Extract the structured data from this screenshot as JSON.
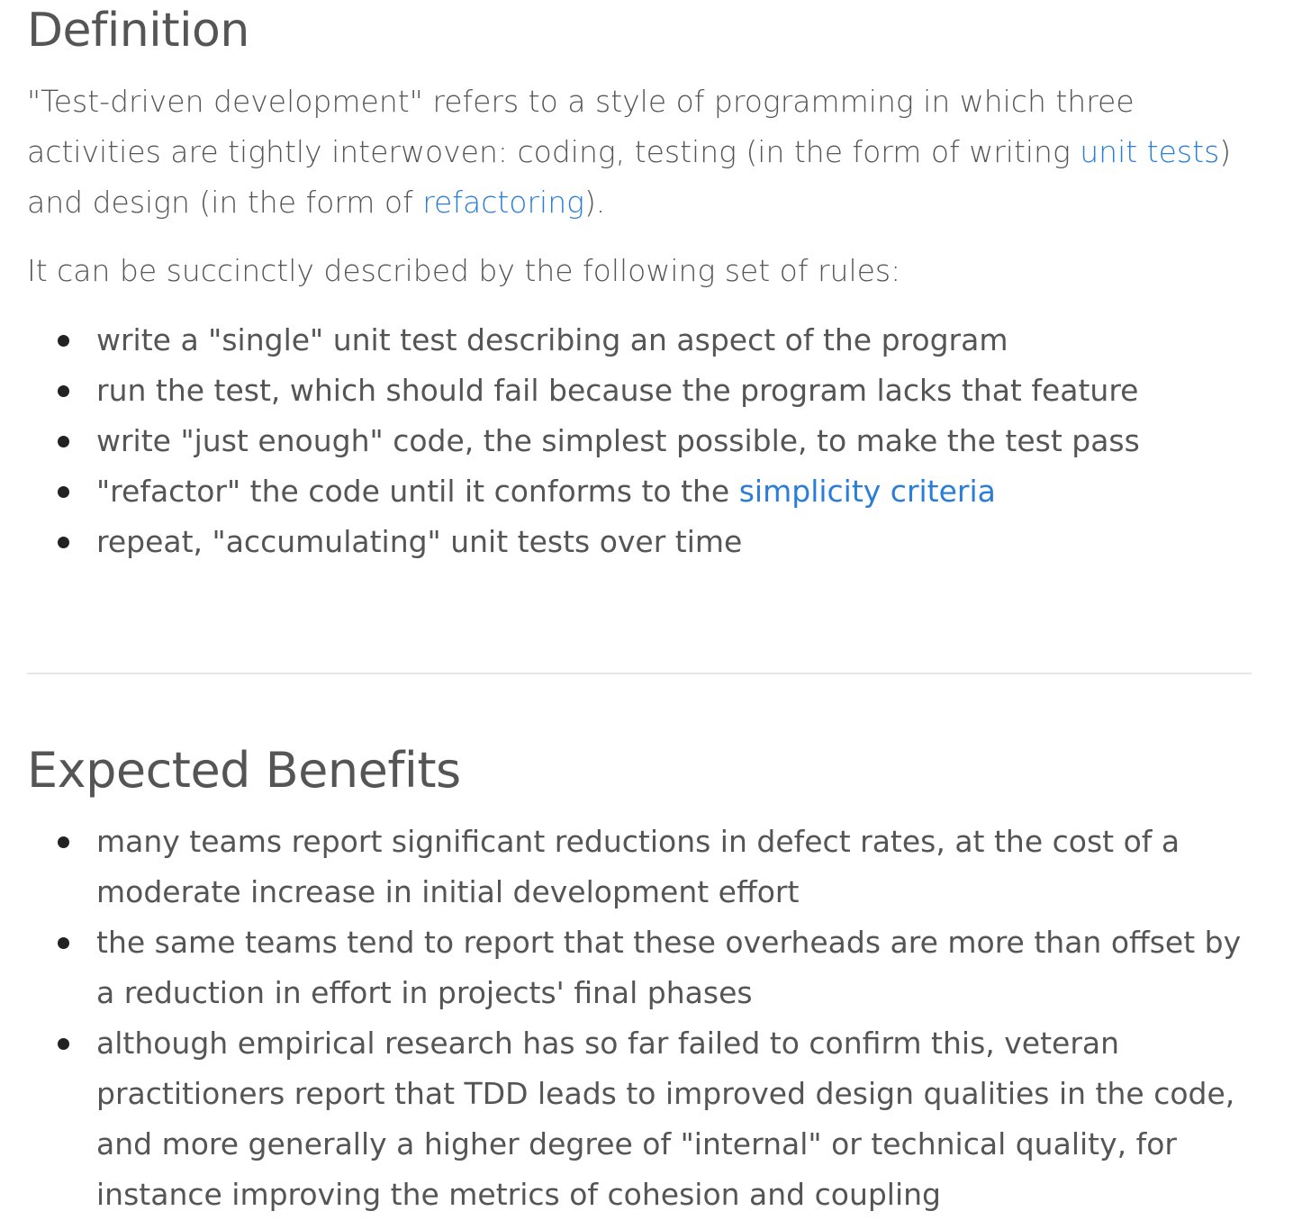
{
  "definition": {
    "title": "Definition",
    "intro": {
      "part1": "\"Test-driven development\" refers to a style of programming in which three activities are tightly interwoven: coding, testing (in the form of writing ",
      "link1": "unit tests",
      "part2": ") and design (in the form of ",
      "link2": "refactoring",
      "part3": ")."
    },
    "rules_intro": "It can be succinctly described by the following set of rules:",
    "rules": [
      {
        "text": "write a \"single\" unit test describing an aspect of the program"
      },
      {
        "text": "run the test, which should fail because the program lacks that feature"
      },
      {
        "text": "write \"just enough\" code, the simplest possible, to make the test pass"
      },
      {
        "text": "\"refactor\" the code until it conforms to the ",
        "link": "simplicity criteria"
      },
      {
        "text": "repeat, \"accumulating\" unit tests over time"
      }
    ]
  },
  "benefits": {
    "title": "Expected Benefits",
    "items": [
      "many teams report significant reductions in defect rates, at the cost of a moderate increase in initial development effort",
      "the same teams tend to report that these overheads are more than offset by a reduction in effort in projects' final phases",
      "although empirical research has so far failed to confirm this, veteran practitioners report that TDD leads to improved design qualities in the code, and more generally a higher degree of \"internal\" or technical quality, for instance improving the metrics of cohesion and coupling"
    ]
  },
  "colors": {
    "text": "#555555",
    "link": "#2a7ed8",
    "bullet": "#222222",
    "divider": "#e6e6e6"
  }
}
